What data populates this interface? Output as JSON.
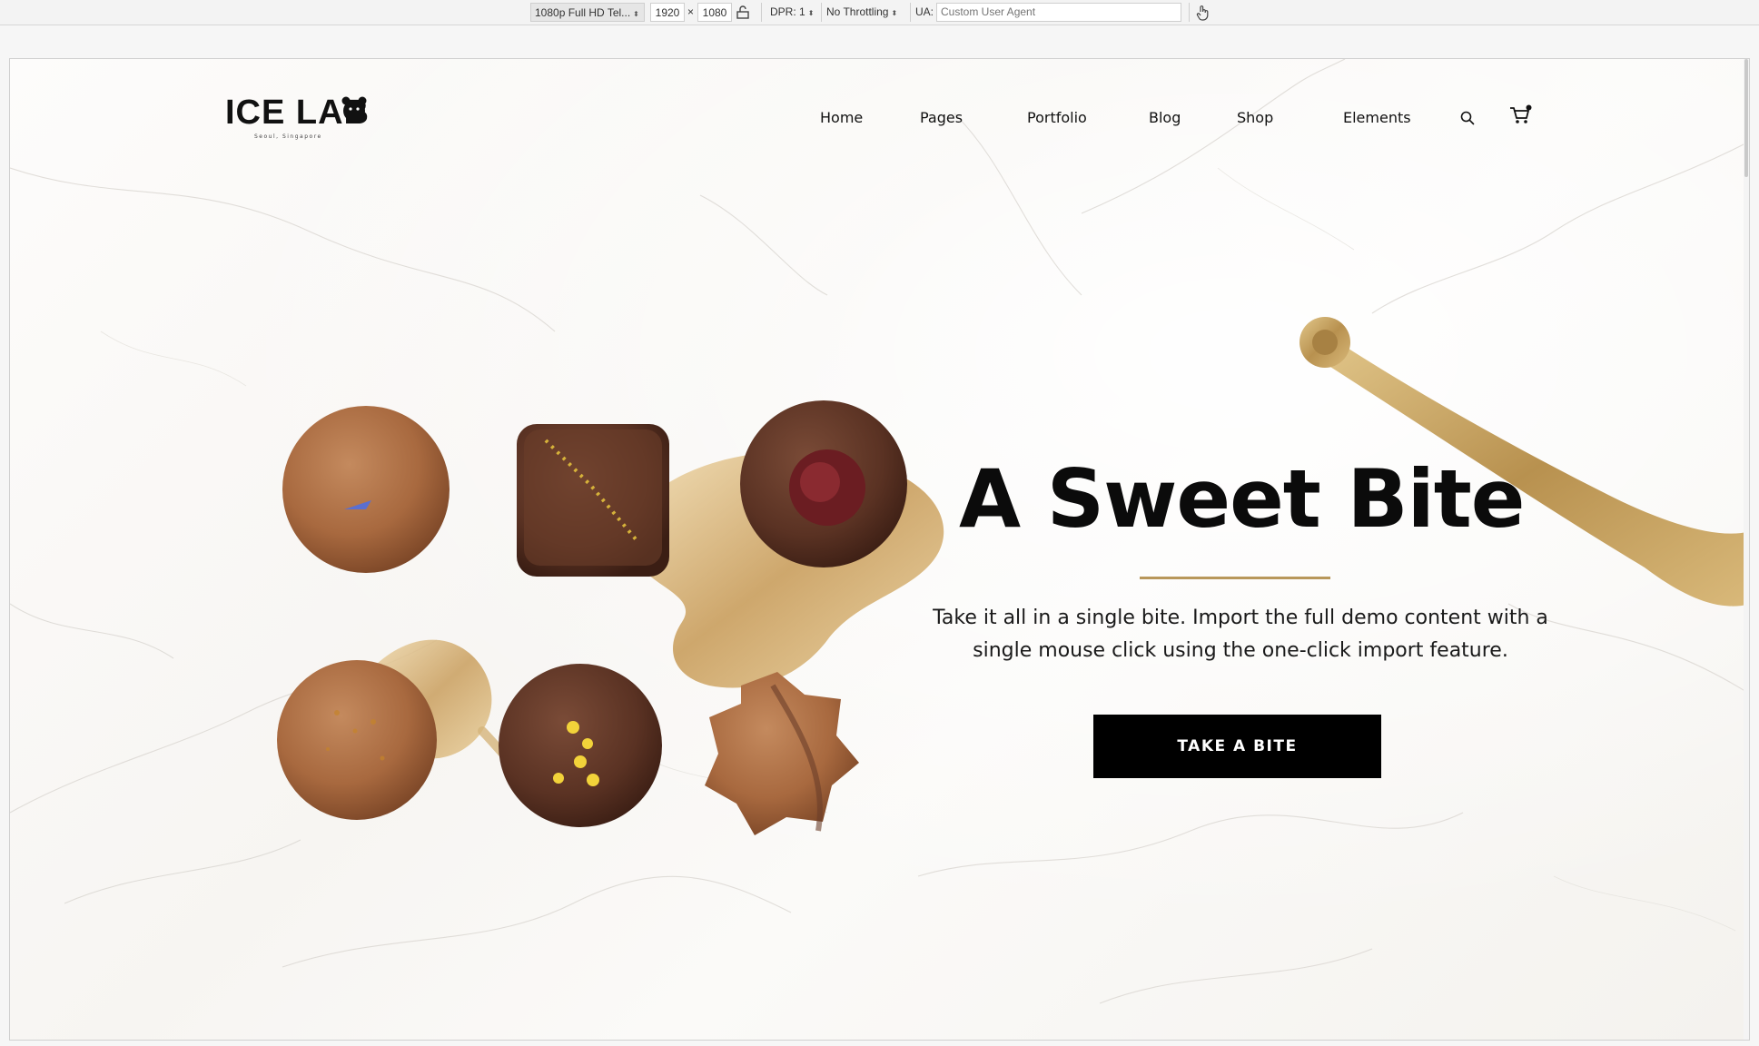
{
  "devtools": {
    "device": "1080p Full HD Tel...",
    "width": "1920",
    "times": "×",
    "height": "1080",
    "dpr": "DPR: 1",
    "throttling": "No Throttling",
    "ua_label": "UA:",
    "ua_placeholder": "Custom User Agent"
  },
  "header": {
    "logo_text": "ICE LAB",
    "logo_sub": "Seoul, Singapore",
    "nav": [
      "Home",
      "Pages",
      "Portfolio",
      "Blog",
      "Shop",
      "Elements"
    ]
  },
  "hero": {
    "title": "A Sweet Bite",
    "text": "Take it all in a single bite. Import the full demo content with a single mouse click using the one-click import feature.",
    "button": "TAKE A BITE"
  },
  "colors": {
    "accent_gold": "#b8975a",
    "button_bg": "#000000",
    "text": "#111111"
  },
  "icons": [
    "search-icon",
    "cart-icon",
    "bear-icon",
    "rotate-icon",
    "touch-icon"
  ]
}
